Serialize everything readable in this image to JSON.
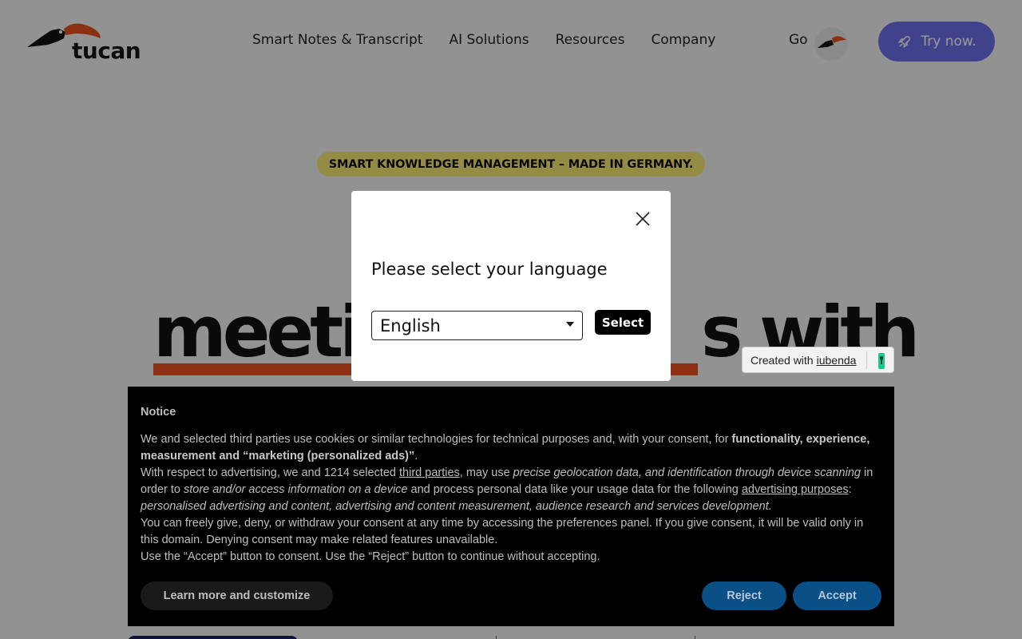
{
  "header": {
    "logo_text": "tucan",
    "nav": [
      "Smart Notes & Transcript",
      "AI Solutions",
      "Resources",
      "Company"
    ],
    "lang_label": "Go",
    "cta_label": "Try now.",
    "cta_icon": "rocket-icon"
  },
  "hero": {
    "tagline": "SMART KNOWLEDGE MANAGEMENT – MADE IN GERMANY.",
    "headline_left": "meetin",
    "headline_right": "s with"
  },
  "language_modal": {
    "title": "Please select your language",
    "selected": "English",
    "button": "Select",
    "close_icon": "close-icon"
  },
  "iubenda_badge": {
    "prefix": "Created with",
    "link": "iubenda"
  },
  "cookie_notice": {
    "title": "Notice",
    "p1_a": "We and selected third parties use cookies or similar technologies for technical purposes and, with your consent, for ",
    "p1_b": "functionality, experience, measurement and “marketing (personalized ads)”",
    "p1_c": ".",
    "p2_a": "With respect to advertising, we and 1214 selected ",
    "p2_link1": "third parties",
    "p2_b": ", may use ",
    "p2_i1": "precise geolocation data, and identification through device scanning",
    "p2_c": " in order to ",
    "p2_i2": "store and/or access information on a device",
    "p2_d": " and process personal data like your usage data for the following ",
    "p2_link2": "advertising purposes",
    "p2_e": ": ",
    "p2_i3": "personalised advertising and content, advertising and content measurement, audience research and services development.",
    "p3": "You can freely give, deny, or withdraw your consent at any time by accessing the preferences panel. If you give consent, it will be valid only in this domain. Denying consent may make related features unavailable.",
    "p4": "Use the “Accept” button to consent. Use the “Reject” button to continue without accepting.",
    "learn_more": "Learn more and customize",
    "reject": "Reject",
    "accept": "Accept"
  },
  "colors": {
    "cta": "#6b70e8",
    "tagline_bg": "#f7e872",
    "underline": "#e8501e",
    "consent_buttons": "#0b4f87"
  }
}
